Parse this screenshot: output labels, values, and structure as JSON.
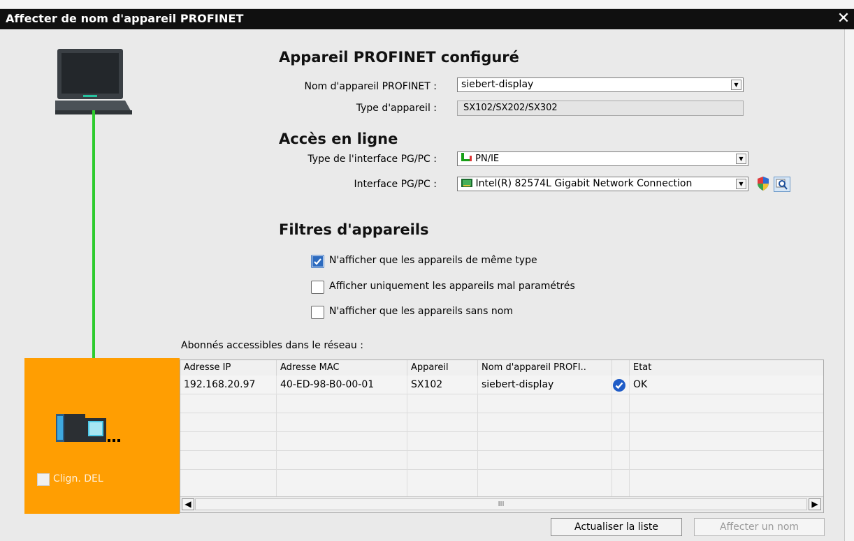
{
  "window": {
    "title": "Affecter de nom d'appareil PROFINET",
    "close_glyph": "✕"
  },
  "configured": {
    "heading": "Appareil PROFINET configuré",
    "device_name_label": "Nom d'appareil PROFINET :",
    "device_name_value": "siebert-display",
    "device_type_label": "Type d'appareil :",
    "device_type_value": "SX102/SX202/SX302"
  },
  "online": {
    "heading": "Accès en ligne",
    "interface_type_label": "Type de l'interface PG/PC :",
    "interface_type_value": "PN/IE",
    "interface_label": "Interface PG/PC :",
    "interface_value": "Intel(R) 82574L Gigabit Network Connection"
  },
  "filters": {
    "heading": "Filtres d'appareils",
    "options": [
      {
        "label": "N'afficher que les appareils de même type",
        "checked": true
      },
      {
        "label": "Afficher uniquement les appareils mal paramétrés",
        "checked": false
      },
      {
        "label": "N'afficher que les appareils sans nom",
        "checked": false
      }
    ]
  },
  "table": {
    "caption": "Abonnés accessibles dans le réseau :",
    "columns": [
      "Adresse IP",
      "Adresse MAC",
      "Appareil",
      "Nom  d'appareil PROFI..",
      "",
      "Etat"
    ],
    "rows": [
      {
        "ip": "192.168.20.97",
        "mac": "40-ED-98-B0-00-01",
        "device": "SX102",
        "name": "siebert-display",
        "status_icon": "check-icon",
        "status": "OK"
      }
    ],
    "scroll_thumb": "III"
  },
  "left_panel": {
    "blink_label": "Clign. DEL",
    "blink_checked": false,
    "device_suffix": "..."
  },
  "buttons": {
    "refresh": "Actualiser la liste",
    "assign": "Affecter un nom"
  },
  "colors": {
    "accent_orange": "#ff9e02",
    "link_green": "#2ecc2e",
    "check_blue": "#2d6bbf"
  }
}
